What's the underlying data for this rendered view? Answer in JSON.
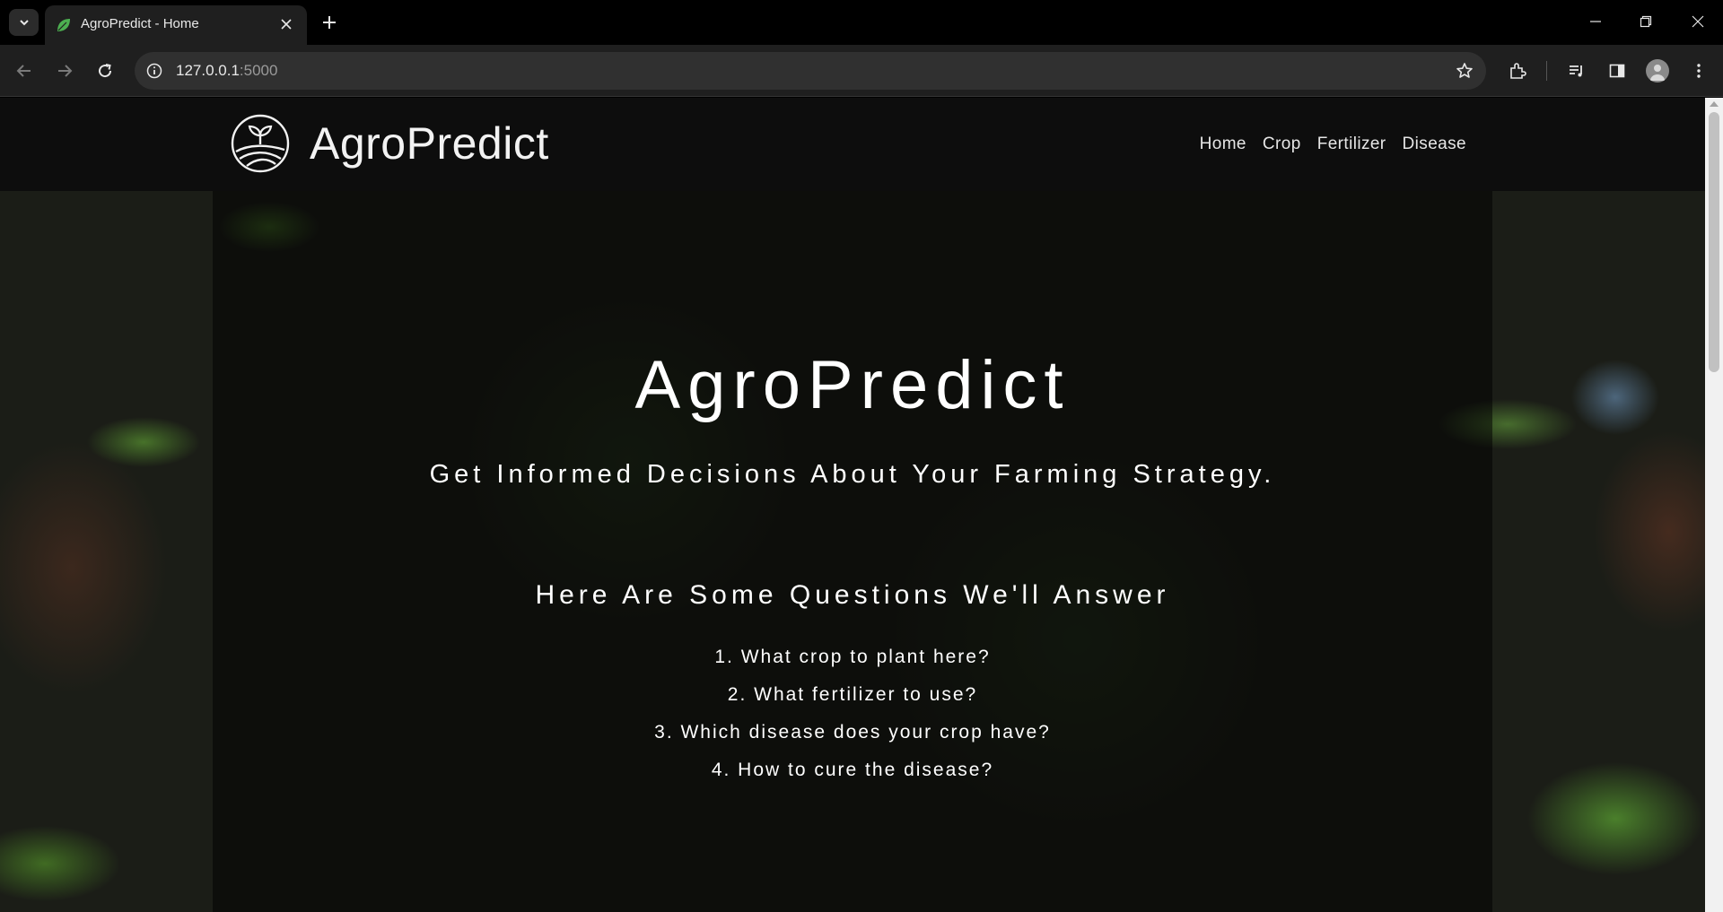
{
  "browser": {
    "tab_title": "AgroPredict - Home",
    "url_host": "127.0.0.1",
    "url_port": ":5000"
  },
  "site": {
    "logo_text": "AgroPredict",
    "nav": [
      "Home",
      "Crop",
      "Fertilizer",
      "Disease"
    ]
  },
  "hero": {
    "title": "AgroPredict",
    "subtitle": "Get Informed Decisions About Your Farming Strategy.",
    "questions_heading": "Here Are Some Questions We'll Answer",
    "questions": [
      "1. What crop to plant here?",
      "2. What fertilizer to use?",
      "3. Which disease does your crop have?",
      "4. How to cure the disease?"
    ]
  },
  "colors": {
    "header_bg": "#0d0d0d",
    "favicon_green": "#4caf50"
  }
}
